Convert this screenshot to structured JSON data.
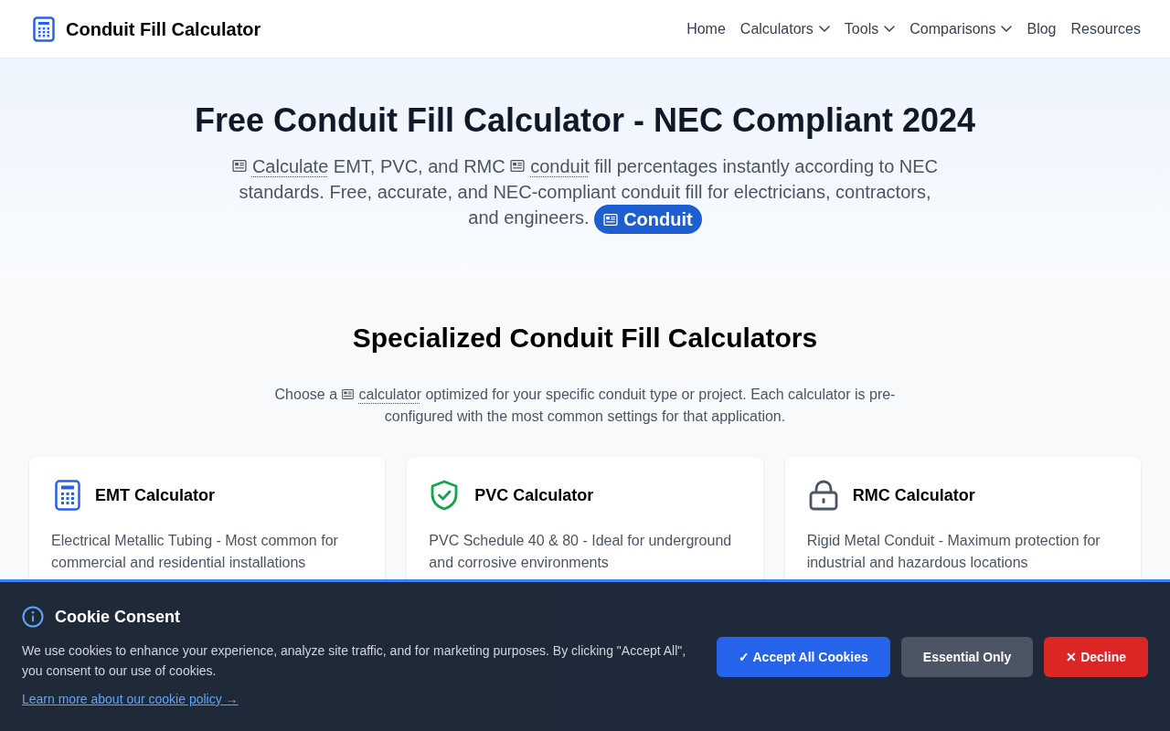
{
  "header": {
    "logo_text": "Conduit Fill Calculator",
    "nav": [
      {
        "label": "Home",
        "kind": "link"
      },
      {
        "label": "Calculators",
        "kind": "dropdown"
      },
      {
        "label": "Tools",
        "kind": "dropdown"
      },
      {
        "label": "Comparisons",
        "kind": "dropdown"
      },
      {
        "label": "Blog",
        "kind": "link"
      },
      {
        "label": "Resources",
        "kind": "link"
      }
    ]
  },
  "hero": {
    "title": "Free Conduit Fill Calculator - NEC Compliant 2024",
    "description": [
      {
        "kind": "term",
        "text": "Calculate"
      },
      {
        "kind": "text",
        "text": " EMT, PVC, and RMC "
      },
      {
        "kind": "term",
        "text": "conduit"
      },
      {
        "kind": "text",
        "text": " fill percentages instantly according to NEC standards. Free, accurate, and NEC-compliant conduit fill for electricians, contractors, and engineers. "
      },
      {
        "kind": "badge",
        "text": "Conduit"
      }
    ]
  },
  "calculators": {
    "title": "Specialized Conduit Fill Calculators",
    "intro": [
      {
        "kind": "text",
        "text": "Choose a "
      },
      {
        "kind": "term",
        "text": "calculator"
      },
      {
        "kind": "text",
        "text": " optimized for your specific conduit type or project. Each calculator is pre-configured with the most common settings for that application."
      }
    ],
    "cards": [
      {
        "title": "EMT Calculator",
        "description": "Electrical Metallic Tubing - Most common for commercial and residential installations"
      },
      {
        "title": "PVC Calculator",
        "description": "PVC Schedule 40 & 80 - Ideal for underground and corrosive environments"
      },
      {
        "title": "RMC Calculator",
        "description": "Rigid Metal Conduit - Maximum protection for industrial and hazardous locations"
      }
    ]
  },
  "cookie_banner": {
    "title": "Cookie Consent",
    "text": "We use cookies to enhance your experience, analyze site traffic, and for marketing purposes. By clicking \"Accept All\", you consent to our use of cookies.",
    "link": "Learn more about our cookie policy →",
    "buttons": [
      {
        "label": "✓ Accept All Cookies",
        "kind": "primary"
      },
      {
        "label": "Essential Only",
        "kind": "secondary"
      },
      {
        "label": "✕ Decline",
        "kind": "danger"
      }
    ]
  }
}
